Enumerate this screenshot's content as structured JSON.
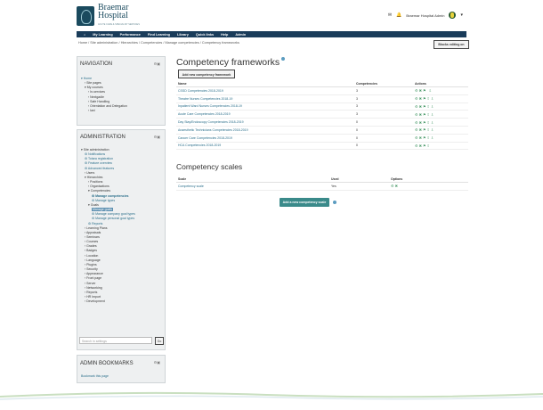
{
  "header": {
    "logo_line1": "Braemar",
    "logo_line2": "Hospital",
    "logo_tagline": "ACUTE CARE & SPECIALIST SERVICES",
    "user_name": "Braemar Hospital Admin"
  },
  "nav": [
    "My Learning",
    "Performance",
    "Find Learning",
    "Library",
    "Quick links",
    "Help",
    "Admin"
  ],
  "breadcrumb": "Home / Site administration / Hierarchies / Competencies / Manage competencies / Competency frameworks",
  "blocks_editing_label": "Blocks editing on",
  "navigation_block": {
    "title": "NAVIGATION",
    "items": [
      "▾ Home",
      "› Site pages",
      "▾ My courses",
      "› In-services",
      "› Nextgadle",
      "› Safe Handling",
      "› Orientation and Delegation",
      "› Iani"
    ]
  },
  "admin_block": {
    "title": "ADMINISTRATION",
    "items": [
      "▾ Site administration",
      "⚙ Notifications",
      "⚙ Totara registration",
      "⚙ Feature overview",
      "⚙ Advanced features",
      "› Users",
      "▾ Hierarchies",
      "› Positions",
      "› Organisations",
      "▾ Competencies",
      "⚙ Manage competencies",
      "⚙ Manage types",
      "▾ Goals",
      "Manage goals",
      "⚙ Manage company goal types",
      "⚙ Manage personal goal types",
      "⚙ Reports",
      "› Learning Plans",
      "› Appraisals",
      "› Seminars",
      "› Courses",
      "› Grades",
      "› Badges",
      "› Location",
      "› Language",
      "› Plugins",
      "› Security",
      "› Appearance",
      "› Front page",
      "› Server",
      "› Networking",
      "› Reports",
      "› HR Import",
      "› Development"
    ],
    "search_placeholder": "Search in settings",
    "go_label": "Go"
  },
  "bookmarks_block": {
    "title": "ADMIN BOOKMARKS",
    "link": "Bookmark this page"
  },
  "frameworks": {
    "title": "Competency frameworks",
    "add_button": "Add new competency framework",
    "headers": [
      "Name",
      "Competencies",
      "Actions"
    ],
    "rows": [
      [
        "CSSD Competencies 2018-2019",
        "3",
        "⚙✖⚑ ⇩"
      ],
      [
        "Theatre Nurses Competencies 2018-19",
        "3",
        "⚙✖⚑⇧⇩"
      ],
      [
        "Inpatient Ward Nurses Competencies 2018-19",
        "3",
        "⚙✖⚑⇧⇩"
      ],
      [
        "Acute Care Competencies 2018-2019",
        "3",
        "⚙✖⚑⇧⇩"
      ],
      [
        "Day Stay/Endoscopy Competencies 2018-2019",
        "0",
        "⚙✖⚑⇧⇩"
      ],
      [
        "Anaesthetic Technicians Competencies 2018-2019",
        "0",
        "⚙✖⚑⇧⇩"
      ],
      [
        "Cancer Care Competencies 2018-2019",
        "0",
        "⚙✖⚑⇧⇩"
      ],
      [
        "HCA Competencies 2018-2019",
        "0",
        "⚙✖⚑⇧"
      ]
    ]
  },
  "scales": {
    "title": "Competency scales",
    "headers": [
      "Scale",
      "Used",
      "Options"
    ],
    "rows": [
      [
        "Competency scale",
        "Yes",
        "⚙✖"
      ]
    ],
    "add_button": "Add a new competency scale"
  }
}
